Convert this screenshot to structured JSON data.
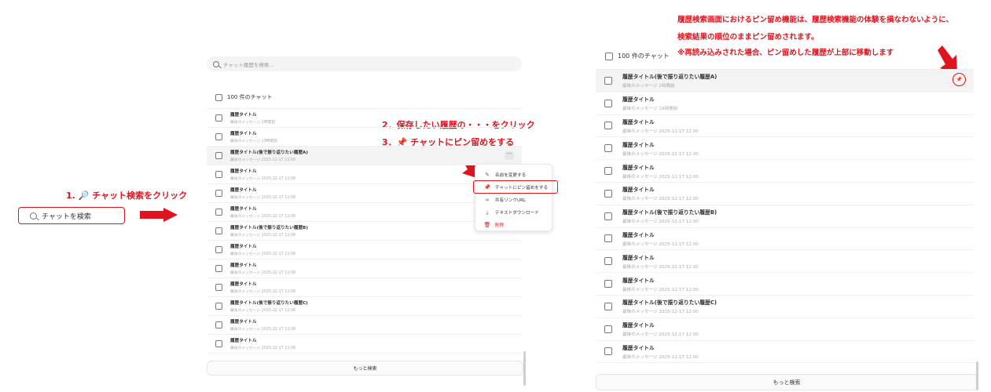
{
  "annotations": {
    "step1": "1. 🔎 チャット検索をクリック",
    "step2": "2．保存したい履歴の・・・をクリック",
    "step3": "3．📌 チャットにピン留めをする",
    "note_line1": "履歴検索画面におけるピン留め機能は、履歴検索機能の体験を損なわないように、",
    "note_line2": "検索結果の順位のままピン留めされます。",
    "note_line3": "※再読み込みされた場合、ピン留めした履歴が上部に移動します"
  },
  "sidebar_search": {
    "label": "チャットを検索"
  },
  "history_panel": {
    "search_placeholder": "チャット履歴を検索...",
    "count_label": "100 件のチャット",
    "more_button": "もっと検索",
    "rows": [
      {
        "title": "履歴タイトル",
        "sub": "最後のメッセージ 2時間前"
      },
      {
        "title": "履歴タイトル",
        "sub": "最後のメッセージ 19時間前"
      },
      {
        "title": "履歴タイトル(後で振り返りたい履歴A)",
        "sub": "最後のメッセージ 2025-12-17 12:00"
      },
      {
        "title": "履歴タイトル",
        "sub": "最後のメッセージ 2025-12-17 12:00"
      },
      {
        "title": "履歴タイトル",
        "sub": "最後のメッセージ 2025-12-17 12:00"
      },
      {
        "title": "履歴タイトル",
        "sub": "最後のメッセージ 2025-12-17 12:00"
      },
      {
        "title": "履歴タイトル(後で振り返りたい履歴B)",
        "sub": "最後のメッセージ 2025-12-17 12:00"
      },
      {
        "title": "履歴タイトル",
        "sub": "最後のメッセージ 2025-12-17 12:00"
      },
      {
        "title": "履歴タイトル",
        "sub": "最後のメッセージ 2025-12-17 12:00"
      },
      {
        "title": "履歴タイトル",
        "sub": "最後のメッセージ 2025-12-17 12:00"
      },
      {
        "title": "履歴タイトル(後で振り返りたい履歴C)",
        "sub": "最後のメッセージ 2025-12-17 12:00"
      },
      {
        "title": "履歴タイトル",
        "sub": "最後のメッセージ 2025-12-17 12:00"
      },
      {
        "title": "履歴タイトル",
        "sub": "最後のメッセージ 2025-12-17 12:00"
      }
    ],
    "ellipsis_label": "···"
  },
  "context_menu": {
    "items": [
      {
        "label": "名前を変更する",
        "icon": "✎"
      },
      {
        "label": "チャットにピン留めをする",
        "icon": "📌"
      },
      {
        "label": "共有リンクURL",
        "icon": "∞"
      },
      {
        "label": "テキストダウンロード",
        "icon": "⤓"
      },
      {
        "label": "削除",
        "icon": "🗑"
      }
    ]
  },
  "result_panel": {
    "count_label": "100 件のチャット",
    "more_button": "もっと検索",
    "pin_icon": "📌",
    "rows": [
      {
        "title": "履歴タイトル(後で振り返りたい履歴A)",
        "sub": "最後のメッセージ 2時間前"
      },
      {
        "title": "履歴タイトル",
        "sub": "最後のメッセージ 19時間前"
      },
      {
        "title": "履歴タイトル",
        "sub": "最後のメッセージ 2025-12-17 12:00"
      },
      {
        "title": "履歴タイトル",
        "sub": "最後のメッセージ 2025-12-17 12:00"
      },
      {
        "title": "履歴タイトル",
        "sub": "最後のメッセージ 2025-12-17 12:00"
      },
      {
        "title": "履歴タイトル",
        "sub": "最後のメッセージ 2025-12-17 12:00"
      },
      {
        "title": "履歴タイトル(後で振り返りたい履歴B)",
        "sub": "最後のメッセージ 2025-12-17 12:00"
      },
      {
        "title": "履歴タイトル",
        "sub": "最後のメッセージ 2025-12-17 12:00"
      },
      {
        "title": "履歴タイトル",
        "sub": "最後のメッセージ 2025-12-17 12:00"
      },
      {
        "title": "履歴タイトル",
        "sub": "最後のメッセージ 2025-12-17 12:00"
      },
      {
        "title": "履歴タイトル(後で振り返りたい履歴C)",
        "sub": "最後のメッセージ 2025-12-17 12:00"
      },
      {
        "title": "履歴タイトル",
        "sub": "最後のメッセージ 2025-12-17 12:00"
      },
      {
        "title": "履歴タイトル",
        "sub": "最後のメッセージ 2025-12-17 12:00"
      }
    ]
  },
  "colors": {
    "accent": "#e0141e",
    "highlight_row": "#f4f4f5"
  }
}
